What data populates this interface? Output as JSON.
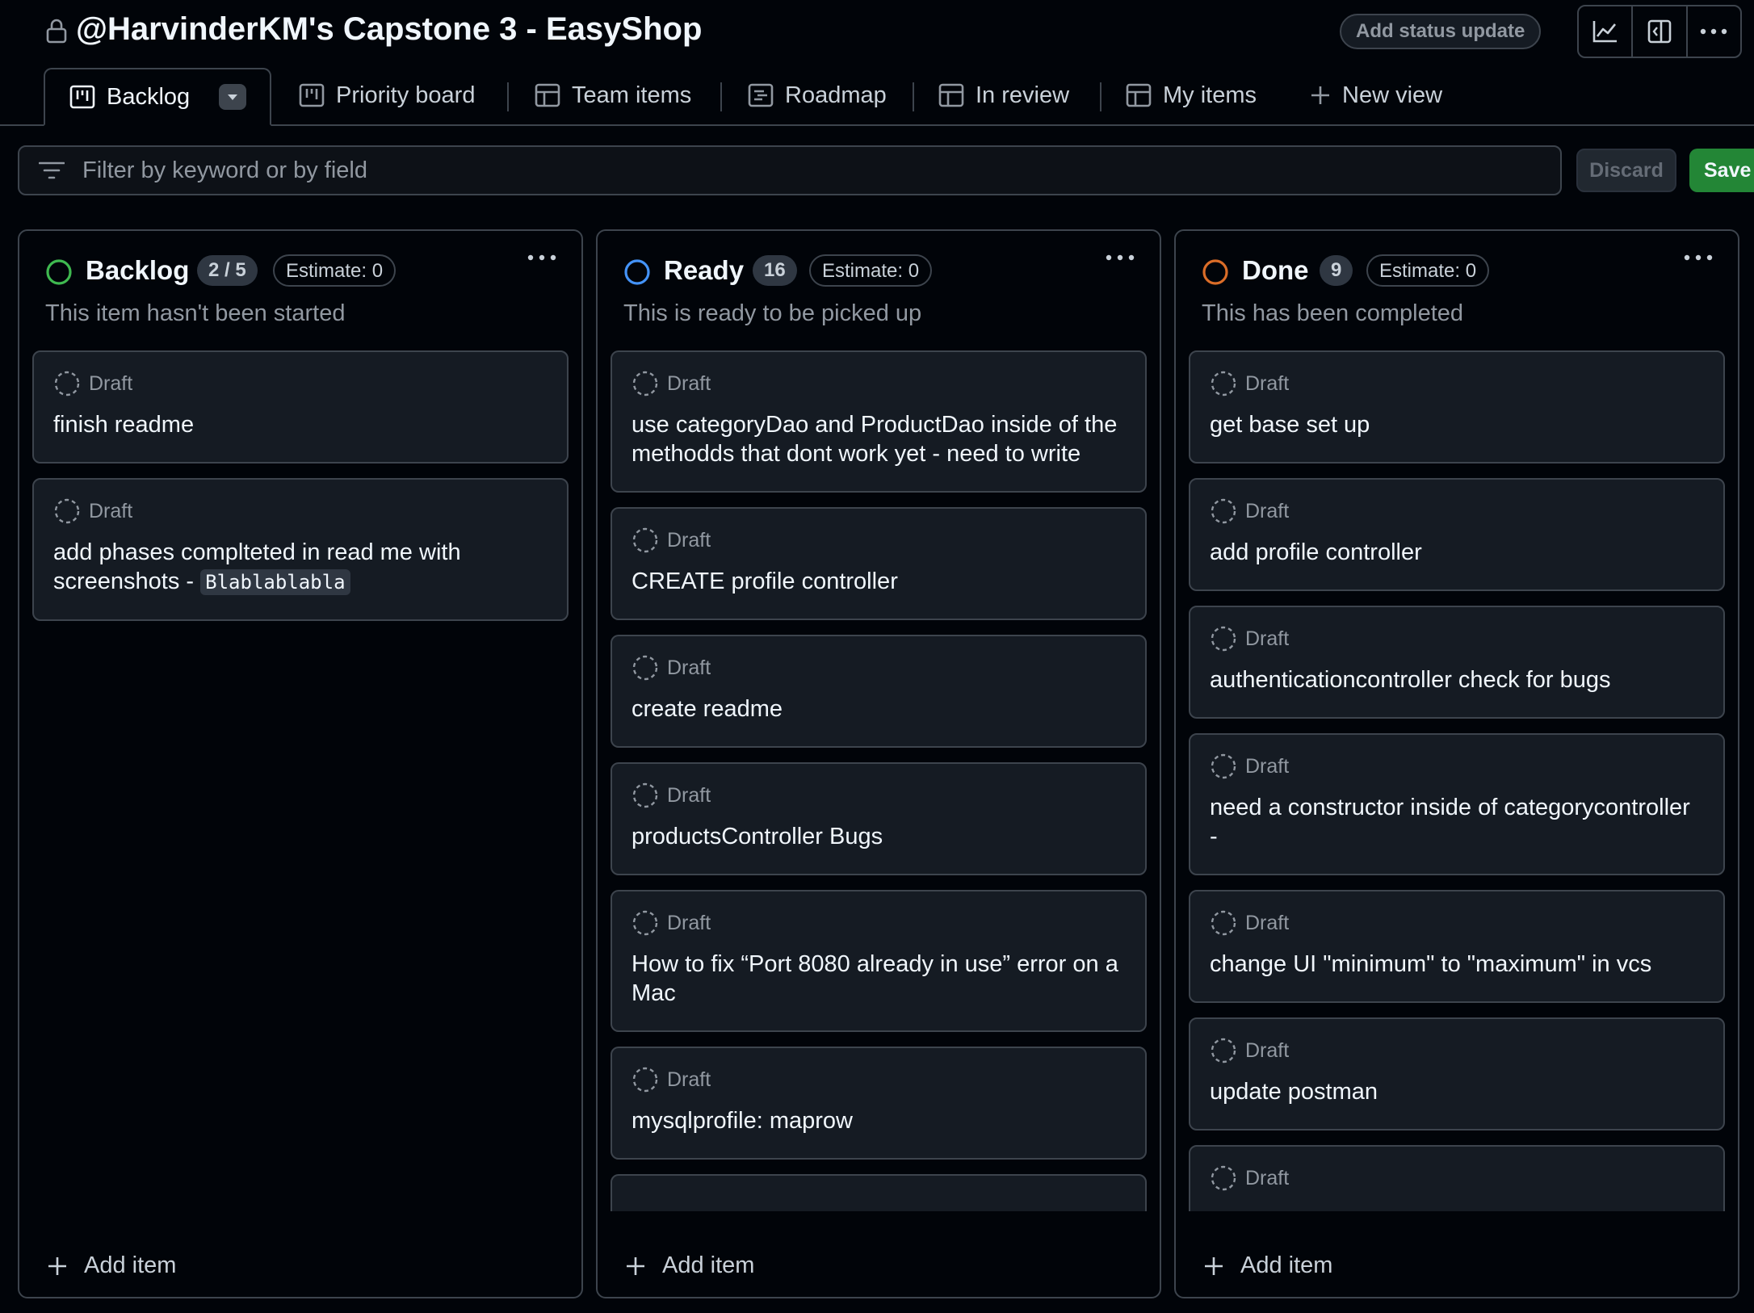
{
  "project": {
    "title": "@HarvinderKM's Capstone 3 - EasyShop",
    "status_update_label": "Add status update",
    "header_icons": [
      "insights-icon",
      "side-panel-icon",
      "kebab-menu-icon"
    ]
  },
  "tabs": [
    {
      "label": "Backlog",
      "icon": "board-icon",
      "active": true
    },
    {
      "label": "Priority board",
      "icon": "board-icon"
    },
    {
      "label": "Team items",
      "icon": "table-icon"
    },
    {
      "label": "Roadmap",
      "icon": "roadmap-icon"
    },
    {
      "label": "In review",
      "icon": "table-icon"
    },
    {
      "label": "My items",
      "icon": "table-icon"
    },
    {
      "label": "New view",
      "icon": "plus-icon"
    }
  ],
  "filter": {
    "placeholder": "Filter by keyword or by field",
    "discard_label": "Discard",
    "save_label": "Save"
  },
  "columns": [
    {
      "name": "Backlog",
      "count": "2 / 5",
      "estimate": "Estimate: 0",
      "description": "This item hasn't been started",
      "color": "#3fb950",
      "add_label": "Add item",
      "cards": [
        {
          "meta": "Draft",
          "title": "finish readme"
        },
        {
          "meta": "Draft",
          "title": "add phases complteted in read me with screenshots - ",
          "code": "Blablablabla"
        }
      ]
    },
    {
      "name": "Ready",
      "count": "16",
      "estimate": "Estimate: 0",
      "description": "This is ready to be picked up",
      "color": "#4493f8",
      "add_label": "Add item",
      "cards": [
        {
          "meta": "Draft",
          "title": "use categoryDao and ProductDao inside of the methodds that dont work yet - need to write"
        },
        {
          "meta": "Draft",
          "title": "CREATE profile controller"
        },
        {
          "meta": "Draft",
          "title": "create readme"
        },
        {
          "meta": "Draft",
          "title": "productsController Bugs"
        },
        {
          "meta": "Draft",
          "title": "How to fix “Port 8080 already in use” error on a Mac"
        },
        {
          "meta": "Draft",
          "title": "mysqlprofile: maprow"
        }
      ]
    },
    {
      "name": "Done",
      "count": "9",
      "estimate": "Estimate: 0",
      "description": "This has been completed",
      "color": "#db6d28",
      "add_label": "Add item",
      "cards": [
        {
          "meta": "Draft",
          "title": "get base set up"
        },
        {
          "meta": "Draft",
          "title": "add profile controller"
        },
        {
          "meta": "Draft",
          "title": "authenticationcontroller check for bugs"
        },
        {
          "meta": "Draft",
          "title": "need a constructor inside of categorycontroller -"
        },
        {
          "meta": "Draft",
          "title": "change UI \"minimum\" to \"maximum\" in vcs"
        },
        {
          "meta": "Draft",
          "title": "update postman"
        },
        {
          "meta": "Draft",
          "title": ""
        }
      ]
    }
  ]
}
